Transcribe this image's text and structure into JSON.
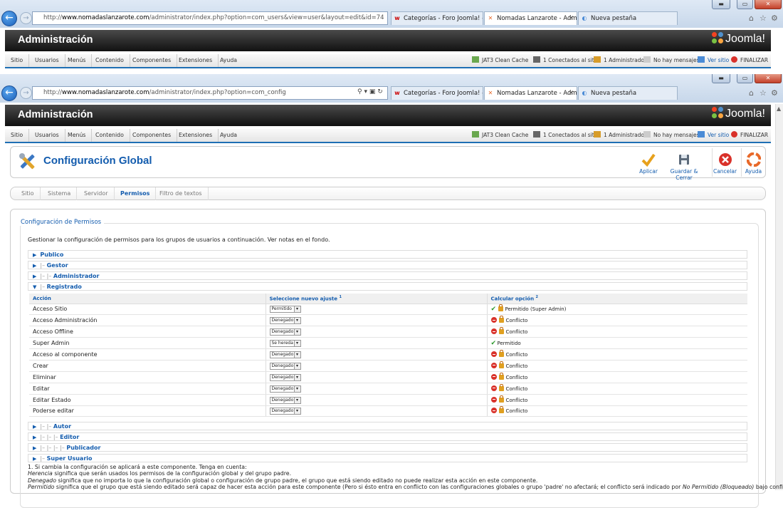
{
  "browser_back": {
    "url_host": "www.nomadaslanzarote.com",
    "url_prefix": "http://",
    "url_path": "/administrator/index.php?option=com_users&view=user&layout=edit&id=74",
    "tabs": [
      {
        "label": "Categorías - Foro Joomla! - Ser..."
      },
      {
        "label": "Nomadas Lanzarote - Admi..."
      },
      {
        "label": "Nueva pestaña"
      }
    ]
  },
  "browser": {
    "url_prefix": "http://",
    "url_host": "www.nomadaslanzarote.com",
    "url_path": "/administrator/index.php?option=com_config",
    "tabs": [
      {
        "label": "Categorías - Foro Joomla! - Ser..."
      },
      {
        "label": "Nomadas Lanzarote - Admi..."
      },
      {
        "label": "Nueva pestaña"
      }
    ]
  },
  "header": {
    "title": "Administración",
    "logo_text": "Joomla!"
  },
  "menu": {
    "items": [
      "Sitio",
      "Usuarios",
      "Menús",
      "Contenido",
      "Componentes",
      "Extensiones",
      "Ayuda"
    ],
    "status": {
      "cache": "JAT3 Clean Cache",
      "connected": "1 Conectados al sitio",
      "admins": "1 Administrador",
      "messages": "No hay mensajes",
      "view_site": "Ver sitio",
      "logout": "FINALIZAR"
    }
  },
  "page": {
    "title": "Configuración Global",
    "toolbar": {
      "apply": "Aplicar",
      "save_close": "Guardar & Cerrar",
      "cancel": "Cancelar",
      "help": "Ayuda"
    },
    "subtabs": [
      "Sitio",
      "Sistema",
      "Servidor",
      "Permisos",
      "Filtro de textos"
    ],
    "active_subtab": "Permisos"
  },
  "permissions": {
    "legend": "Configuración de Permisos",
    "description": "Gestionar la configuración de permisos para los grupos de usuarios a continuación. Ver notas en el fondo.",
    "groups_top": [
      {
        "prefix": "",
        "name": "Publico"
      },
      {
        "prefix": "|– ",
        "name": "Gestor"
      },
      {
        "prefix": "|– |– ",
        "name": "Administrador"
      }
    ],
    "expanded_group": {
      "prefix": "|– ",
      "name": "Registrado"
    },
    "columns": {
      "action": "Acción",
      "setting": "Seleccione nuevo ajuste",
      "setting_sup": "1",
      "calculated": "Calcular opción",
      "calculated_sup": "2"
    },
    "rows": [
      {
        "action": "Acceso Sitio",
        "setting": "Permitido",
        "result": "Permitido (Super Admin)",
        "state": "allowed-locked"
      },
      {
        "action": "Acceso Administración",
        "setting": "Denegado",
        "result": "Conflicto",
        "state": "conflict"
      },
      {
        "action": "Acceso Offline",
        "setting": "Denegado",
        "result": "Conflicto",
        "state": "conflict"
      },
      {
        "action": "Super Admin",
        "setting": "Se hereda",
        "result": "Permitido",
        "state": "allowed"
      },
      {
        "action": "Acceso al componente",
        "setting": "Denegado",
        "result": "Conflicto",
        "state": "conflict"
      },
      {
        "action": "Crear",
        "setting": "Denegado",
        "result": "Conflicto",
        "state": "conflict"
      },
      {
        "action": "Eliminar",
        "setting": "Denegado",
        "result": "Conflicto",
        "state": "conflict"
      },
      {
        "action": "Editar",
        "setting": "Denegado",
        "result": "Conflicto",
        "state": "conflict"
      },
      {
        "action": "Editar Estado",
        "setting": "Denegado",
        "result": "Conflicto",
        "state": "conflict"
      },
      {
        "action": "Poderse editar",
        "setting": "Denegado",
        "result": "Conflicto",
        "state": "conflict"
      }
    ],
    "groups_bottom": [
      {
        "prefix": "|– |– ",
        "name": "Autor"
      },
      {
        "prefix": "|– |– |– ",
        "name": "Editor"
      },
      {
        "prefix": "|– |– |– |– ",
        "name": "Publicador"
      },
      {
        "prefix": "|– ",
        "name": "Super Usuario"
      }
    ],
    "notes": {
      "line1": "1. Si cambia la configuración se aplicará a este componente. Tenga en cuenta:",
      "l2_term": "Herencia",
      "l2_text": " significa que serán usados los permisos de la configuración global y del grupo padre.",
      "l3_term": "Denegado",
      "l3_text": " significa que no importa lo que la configuración global o configuración de grupo padre, el grupo que está siendo editado no puede realizar esta acción en este componente.",
      "l4_term": "Permitido",
      "l4_text": " significa que el grupo que está siendo editado será capaz de hacer esta acción para este componente (Pero si ésto entra en conflicto con las configuraciones globales o grupo 'padre' no afectará; el conflicto será indicado por ",
      "l4_em": "No Permitido (Bloqueado)",
      "l4_tail": " bajo configuraciones"
    }
  }
}
